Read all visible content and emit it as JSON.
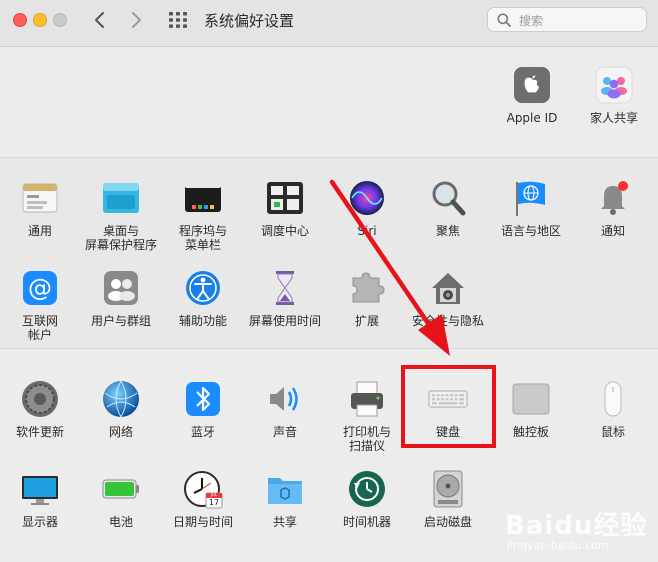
{
  "window": {
    "title": "系统偏好设置"
  },
  "search": {
    "placeholder": "搜索"
  },
  "account": [
    {
      "label": "Apple ID",
      "icon": "apple-logo-icon"
    },
    {
      "label": "家人共享",
      "icon": "family-sharing-icon"
    }
  ],
  "row1": [
    {
      "label": "通用",
      "icon": "general-icon"
    },
    {
      "label": "桌面与\n屏幕保护程序",
      "icon": "desktop-screensaver-icon"
    },
    {
      "label": "程序坞与\n菜单栏",
      "icon": "dock-menubar-icon"
    },
    {
      "label": "调度中心",
      "icon": "mission-control-icon"
    },
    {
      "label": "Siri",
      "icon": "siri-icon"
    },
    {
      "label": "聚焦",
      "icon": "spotlight-magnifier-icon"
    },
    {
      "label": "语言与地区",
      "icon": "language-region-globe-icon"
    },
    {
      "label": "通知",
      "icon": "notification-bell-icon"
    }
  ],
  "row2": [
    {
      "label": "互联网\n帐户",
      "icon": "internet-accounts-at-icon"
    },
    {
      "label": "用户与群组",
      "icon": "users-groups-icon"
    },
    {
      "label": "辅助功能",
      "icon": "accessibility-icon"
    },
    {
      "label": "屏幕使用时间",
      "icon": "screen-time-hourglass-icon"
    },
    {
      "label": "扩展",
      "icon": "extensions-puzzle-icon"
    },
    {
      "label": "安全性与隐私",
      "icon": "security-privacy-house-icon"
    }
  ],
  "row3": [
    {
      "label": "软件更新",
      "icon": "software-update-gear-icon"
    },
    {
      "label": "网络",
      "icon": "network-globe-icon"
    },
    {
      "label": "蓝牙",
      "icon": "bluetooth-icon"
    },
    {
      "label": "声音",
      "icon": "sound-speaker-icon"
    },
    {
      "label": "打印机与\n扫描仪",
      "icon": "printer-scanner-icon"
    },
    {
      "label": "键盘",
      "icon": "keyboard-icon"
    },
    {
      "label": "触控板",
      "icon": "trackpad-icon"
    },
    {
      "label": "鼠标",
      "icon": "mouse-icon"
    }
  ],
  "row4": [
    {
      "label": "显示器",
      "icon": "display-monitor-icon"
    },
    {
      "label": "电池",
      "icon": "battery-icon"
    },
    {
      "label": "日期与时间",
      "icon": "date-time-clock-icon"
    },
    {
      "label": "共享",
      "icon": "sharing-folder-icon"
    },
    {
      "label": "时间机器",
      "icon": "time-machine-icon"
    },
    {
      "label": "启动磁盘",
      "icon": "startup-disk-icon"
    }
  ],
  "calendar": {
    "month": "JUL",
    "day": "17"
  },
  "watermark": {
    "brand": "Baidu经验",
    "sub": "jingyan.baidu.com"
  },
  "colors": {
    "annotation_red": "#e8121b",
    "accent_blue": "#1a8cff"
  }
}
